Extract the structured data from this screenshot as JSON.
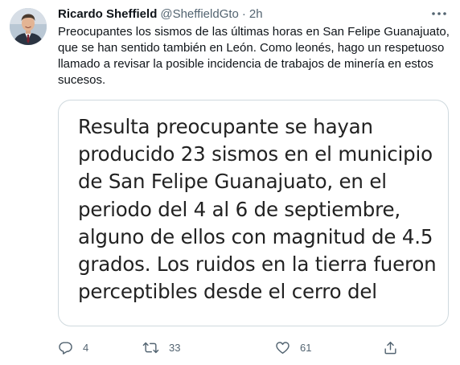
{
  "tweet": {
    "author": {
      "display_name": "Ricardo Sheffield",
      "handle": "@SheffieldGto",
      "separator": "·",
      "time": "2h"
    },
    "text": "Preocupantes los sismos de las últimas horas en San Felipe Guanajuato, que se han sentido también en León. Como leonés, hago un respetuoso llamado a revisar la posible incidencia de trabajos de minería en estos sucesos.",
    "media": {
      "lines": [
        "Resulta preocupante se hayan",
        "producido 23 sismos en el municipio",
        "de San Felipe Guanajuato, en el",
        "periodo del 4 al 6 de septiembre,",
        "alguno de ellos con magnitud de 4.5",
        "grados. Los ruidos en la tierra fueron",
        "perceptibles desde el cerro del"
      ]
    },
    "actions": {
      "replies": "4",
      "retweets": "33",
      "likes": "61"
    },
    "icons": {
      "more": "more-icon",
      "reply": "reply-icon",
      "retweet": "retweet-icon",
      "like": "heart-icon",
      "share": "share-icon"
    },
    "colors": {
      "secondary_text": "#536471",
      "primary_text": "#0f1419",
      "card_border": "#cfd9de"
    }
  }
}
